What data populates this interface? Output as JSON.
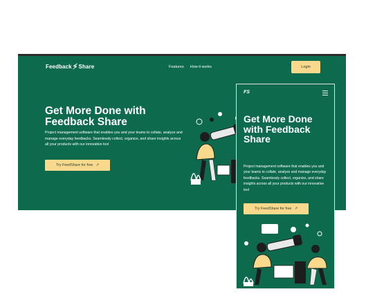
{
  "brand": {
    "logo_left": "Feedback",
    "logo_right": "Share",
    "mobile_logo": "FS"
  },
  "nav": {
    "links": [
      "Features",
      "How it works"
    ],
    "login_label": "Login"
  },
  "hero": {
    "title": "Get More Done with Feedback Share",
    "description": "Project management software that enables you and your teams to collate, analyze and manage everyday feedbacks. Seamlessly collect, organize, and share insights across all your products with our innovative tool",
    "cta_label": "Try FeedShare for free",
    "cta_icon": "arrow-up-right-icon"
  },
  "colors": {
    "brand_green": "#0d6a4c",
    "cta_yellow": "#fbd98c",
    "text": "#ffffff"
  },
  "icons": {
    "menu": "hamburger-menu-icon",
    "logo_mark": "lightning-bolt-icon"
  }
}
